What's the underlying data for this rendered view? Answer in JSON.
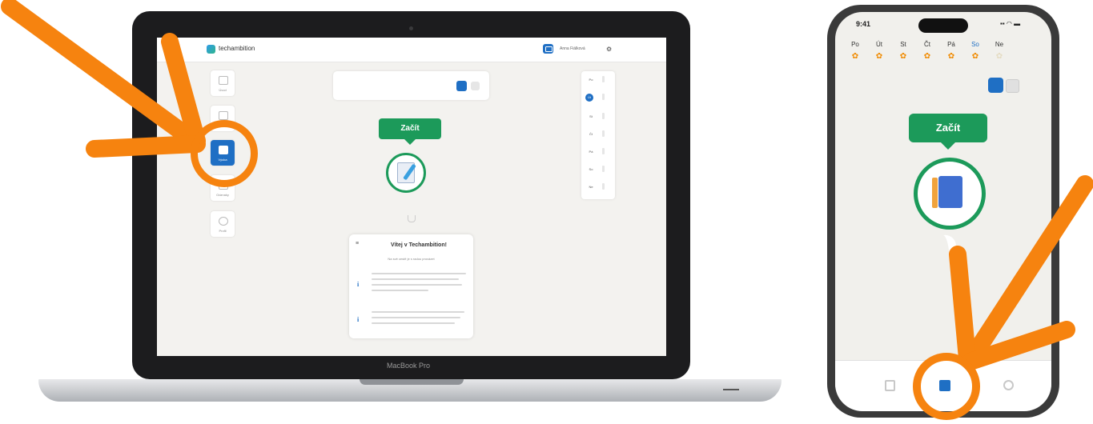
{
  "laptop": {
    "brand_label": "MacBook Pro",
    "app": {
      "logo_text": "techambition",
      "user_name": "Anna Fiálková",
      "nav_items": [
        {
          "label": "Úvod",
          "icon": "grid-icon",
          "active": false
        },
        {
          "label": "Kurzy",
          "icon": "list-icon",
          "active": false
        },
        {
          "label": "Výuka",
          "icon": "book-icon",
          "active": true
        },
        {
          "label": "Odznaky",
          "icon": "badge-icon",
          "active": false
        },
        {
          "label": "Profil",
          "icon": "user-icon",
          "active": false
        }
      ],
      "start_label": "Začít",
      "welcome": {
        "title": "Vítej v Techambition!",
        "subtitle": "Na své cestě je s radou provázet",
        "paragraph_1": "Splněnou lekci označíš zelenou barvou",
        "paragraph_2": "Postupně plň úkoly a sbírej body"
      },
      "days": [
        "Po",
        "Út",
        "St",
        "Čt",
        "Pá",
        "So",
        "Ne"
      ],
      "active_day_index": 1
    }
  },
  "phone": {
    "time": "9:41",
    "status_icons": "▪▪ ◠ ▬",
    "weekdays": [
      "Po",
      "Út",
      "St",
      "Čt",
      "Pá",
      "So",
      "Ne"
    ],
    "today_index": 5,
    "streak_filled": [
      true,
      true,
      true,
      true,
      true,
      true,
      false
    ],
    "start_label": "Začít",
    "tabs": [
      {
        "icon": "grid-icon",
        "active": false
      },
      {
        "icon": "book-icon",
        "active": true
      },
      {
        "icon": "user-icon",
        "active": false
      }
    ]
  },
  "colors": {
    "accent_blue": "#1f6fc4",
    "start_green": "#1c9a5a",
    "annotation_orange": "#f6830f"
  }
}
